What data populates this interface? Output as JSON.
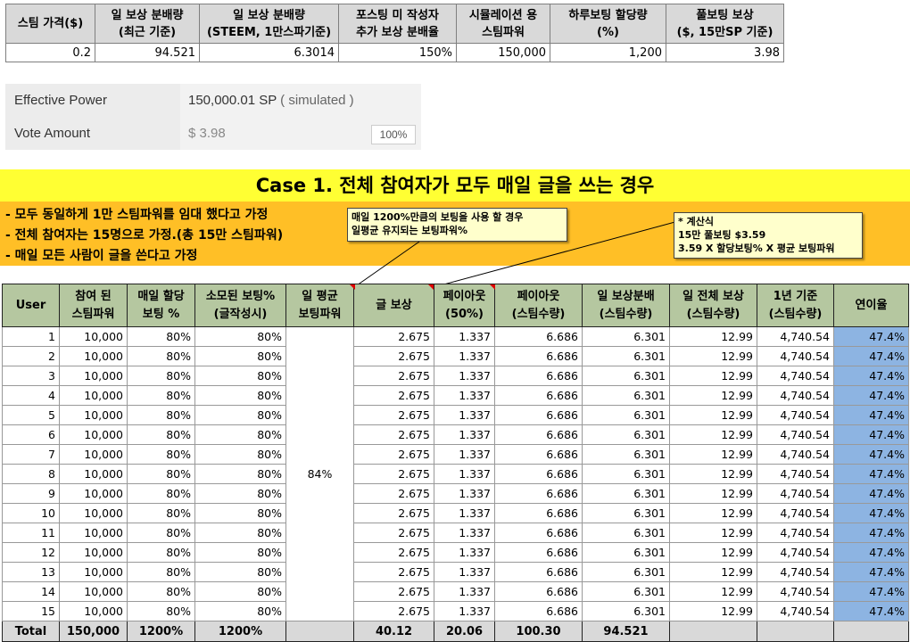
{
  "params": {
    "headers": [
      "스팀 가격($)",
      "일 보상 분배량\n(최근 기준)",
      "일 보상 분배량\n(STEEM, 1만스파기준)",
      "포스팅 미 작성자\n추가 보상 분배율",
      "시뮬레이션 용\n스팀파워",
      "하루보팅 할당량\n(%)",
      "풀보팅 보상\n($, 15만SP 기준)"
    ],
    "values": [
      "0.2",
      "94.521",
      "6.3014",
      "150%",
      "150,000",
      "1,200",
      "3.98"
    ]
  },
  "power_panel": {
    "effective_label": "Effective Power",
    "effective_value": "150,000.01 SP",
    "effective_note": "( simulated )",
    "vote_label": "Vote Amount",
    "vote_value": "$ 3.98",
    "vote_percent": "100%"
  },
  "case": {
    "title": "Case 1. 전체 참여자가 모두 매일 글을 쓰는 경우",
    "assumptions": [
      "- 모두 동일하게 1만 스팀파워를 임대 했다고 가정",
      "- 전체 참여자는 15명으로 가정.(총 15만 스팀파워)",
      "- 매일 모든 사람이 글을 쓴다고 가정"
    ]
  },
  "notes": {
    "note_1200": [
      "매일 1200%만큼의 보팅을 사용 할 경우",
      "일평균 유지되는 보팅파워%"
    ],
    "note_calc": [
      "* 계산식",
      "15만 풀보팅 $3.59",
      "3.59 X 할당보팅% X 평균 보팅파워"
    ]
  },
  "table": {
    "headers": [
      "User",
      "참여 된\n스팀파워",
      "매일 할당\n보팅 %",
      "소모된 보팅%\n(글작성시)",
      "일 평균\n보팅파워",
      "글 보상",
      "페이아웃\n(50%)",
      "페이아웃\n(스팀수량)",
      "일 보상분배\n(스팀수량)",
      "일 전체 보상\n(스팀수량)",
      "1년 기준\n(스팀수량)",
      "연이율"
    ],
    "avg_voting_power": "84%",
    "rows": [
      {
        "user": "1",
        "sp": "10,000",
        "daily": "80%",
        "used": "80%",
        "reward": "2.675",
        "payout": "1.337",
        "payout_steem": "6.686",
        "dist": "6.301",
        "total": "12.99",
        "year": "4,740.54",
        "rate": "47.4%"
      },
      {
        "user": "2",
        "sp": "10,000",
        "daily": "80%",
        "used": "80%",
        "reward": "2.675",
        "payout": "1.337",
        "payout_steem": "6.686",
        "dist": "6.301",
        "total": "12.99",
        "year": "4,740.54",
        "rate": "47.4%"
      },
      {
        "user": "3",
        "sp": "10,000",
        "daily": "80%",
        "used": "80%",
        "reward": "2.675",
        "payout": "1.337",
        "payout_steem": "6.686",
        "dist": "6.301",
        "total": "12.99",
        "year": "4,740.54",
        "rate": "47.4%"
      },
      {
        "user": "4",
        "sp": "10,000",
        "daily": "80%",
        "used": "80%",
        "reward": "2.675",
        "payout": "1.337",
        "payout_steem": "6.686",
        "dist": "6.301",
        "total": "12.99",
        "year": "4,740.54",
        "rate": "47.4%"
      },
      {
        "user": "5",
        "sp": "10,000",
        "daily": "80%",
        "used": "80%",
        "reward": "2.675",
        "payout": "1.337",
        "payout_steem": "6.686",
        "dist": "6.301",
        "total": "12.99",
        "year": "4,740.54",
        "rate": "47.4%"
      },
      {
        "user": "6",
        "sp": "10,000",
        "daily": "80%",
        "used": "80%",
        "reward": "2.675",
        "payout": "1.337",
        "payout_steem": "6.686",
        "dist": "6.301",
        "total": "12.99",
        "year": "4,740.54",
        "rate": "47.4%"
      },
      {
        "user": "7",
        "sp": "10,000",
        "daily": "80%",
        "used": "80%",
        "reward": "2.675",
        "payout": "1.337",
        "payout_steem": "6.686",
        "dist": "6.301",
        "total": "12.99",
        "year": "4,740.54",
        "rate": "47.4%"
      },
      {
        "user": "8",
        "sp": "10,000",
        "daily": "80%",
        "used": "80%",
        "reward": "2.675",
        "payout": "1.337",
        "payout_steem": "6.686",
        "dist": "6.301",
        "total": "12.99",
        "year": "4,740.54",
        "rate": "47.4%"
      },
      {
        "user": "9",
        "sp": "10,000",
        "daily": "80%",
        "used": "80%",
        "reward": "2.675",
        "payout": "1.337",
        "payout_steem": "6.686",
        "dist": "6.301",
        "total": "12.99",
        "year": "4,740.54",
        "rate": "47.4%"
      },
      {
        "user": "10",
        "sp": "10,000",
        "daily": "80%",
        "used": "80%",
        "reward": "2.675",
        "payout": "1.337",
        "payout_steem": "6.686",
        "dist": "6.301",
        "total": "12.99",
        "year": "4,740.54",
        "rate": "47.4%"
      },
      {
        "user": "11",
        "sp": "10,000",
        "daily": "80%",
        "used": "80%",
        "reward": "2.675",
        "payout": "1.337",
        "payout_steem": "6.686",
        "dist": "6.301",
        "total": "12.99",
        "year": "4,740.54",
        "rate": "47.4%"
      },
      {
        "user": "12",
        "sp": "10,000",
        "daily": "80%",
        "used": "80%",
        "reward": "2.675",
        "payout": "1.337",
        "payout_steem": "6.686",
        "dist": "6.301",
        "total": "12.99",
        "year": "4,740.54",
        "rate": "47.4%"
      },
      {
        "user": "13",
        "sp": "10,000",
        "daily": "80%",
        "used": "80%",
        "reward": "2.675",
        "payout": "1.337",
        "payout_steem": "6.686",
        "dist": "6.301",
        "total": "12.99",
        "year": "4,740.54",
        "rate": "47.4%"
      },
      {
        "user": "14",
        "sp": "10,000",
        "daily": "80%",
        "used": "80%",
        "reward": "2.675",
        "payout": "1.337",
        "payout_steem": "6.686",
        "dist": "6.301",
        "total": "12.99",
        "year": "4,740.54",
        "rate": "47.4%"
      },
      {
        "user": "15",
        "sp": "10,000",
        "daily": "80%",
        "used": "80%",
        "reward": "2.675",
        "payout": "1.337",
        "payout_steem": "6.686",
        "dist": "6.301",
        "total": "12.99",
        "year": "4,740.54",
        "rate": "47.4%"
      }
    ],
    "totals": [
      "Total",
      "150,000",
      "1200%",
      "1200%",
      "",
      "40.12",
      "20.06",
      "100.30",
      "94.521",
      "",
      "",
      ""
    ]
  },
  "colors": {
    "banner_yellow": "#ffff33",
    "assumption_orange": "#ffbf26",
    "header_green": "#b5c7a0",
    "rate_blue": "#8db4e2",
    "param_header_gray": "#d9d9d9"
  }
}
